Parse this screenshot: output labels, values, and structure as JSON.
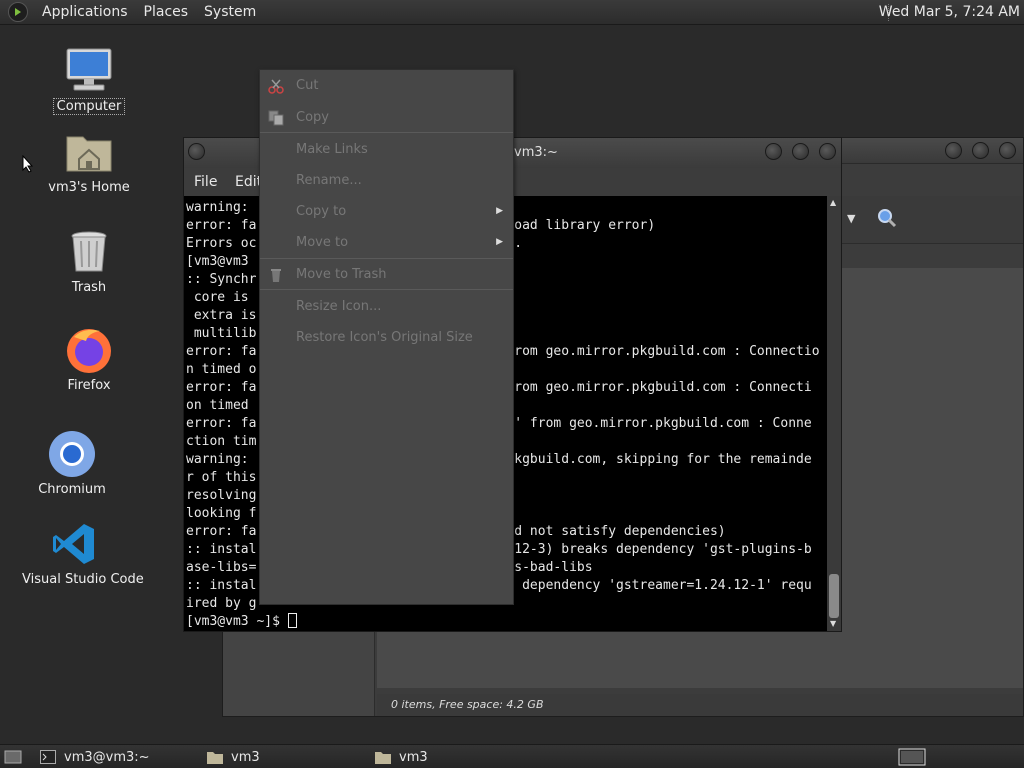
{
  "top_panel": {
    "menus": [
      "Applications",
      "Places",
      "System"
    ],
    "clock": "Wed Mar  5,  7:24 AM"
  },
  "desktop": {
    "icons": [
      {
        "label": "Computer",
        "icon": "computer-icon"
      },
      {
        "label": "vm3's Home",
        "icon": "home-folder-icon"
      },
      {
        "label": "Trash",
        "icon": "trash-icon"
      },
      {
        "label": "Firefox",
        "icon": "firefox-icon"
      },
      {
        "label": "Chromium",
        "icon": "chromium-icon"
      },
      {
        "label": "Visual Studio Code",
        "icon": "vscode-icon"
      }
    ]
  },
  "file_manager": {
    "status": "0 items, Free space: 4.2 GB"
  },
  "terminal": {
    "title": "vm3:~",
    "menus": [
      "File",
      "Edit"
    ],
    "lines": [
      {
        "left": "warning: ",
        "right": ""
      },
      {
        "left": "error: fa",
        "right": "load library error)"
      },
      {
        "left": "Errors oc",
        "right": "d."
      },
      {
        "left": "[vm3@vm3 ",
        "right": ""
      },
      {
        "left": ":: Synchr",
        "right": ""
      },
      {
        "left": " core is ",
        "right": ""
      },
      {
        "left": " extra is",
        "right": ""
      },
      {
        "left": " multilib",
        "right": ""
      },
      {
        "left": "error: fa",
        "right": "from geo.mirror.pkgbuild.com : Connectio"
      },
      {
        "left": "n timed o",
        "right": ""
      },
      {
        "left": "error: fa",
        "right": "from geo.mirror.pkgbuild.com : Connecti"
      },
      {
        "left": "on timed ",
        "right": ""
      },
      {
        "left": "error: fa",
        "right": "b' from geo.mirror.pkgbuild.com : Conne"
      },
      {
        "left": "ction tim",
        "right": ""
      },
      {
        "left": "warning: ",
        "right": "pkgbuild.com, skipping for the remainde"
      },
      {
        "left": "r of this",
        "right": ""
      },
      {
        "left": "resolving",
        "right": ""
      },
      {
        "left": "looking f",
        "right": ""
      },
      {
        "left": "error: fa",
        "right": "ld not satisfy dependencies)"
      },
      {
        "left": ":: instal",
        "right": ".12-3) breaks dependency 'gst-plugins-b"
      },
      {
        "left": "ase-libs=",
        "right": "ns-bad-libs"
      },
      {
        "left": ":: instal",
        "right": "s dependency 'gstreamer=1.24.12-1' requ"
      },
      {
        "left": "ired by g",
        "right": ""
      }
    ],
    "prompt": "[vm3@vm3 ~]$ "
  },
  "context_menu": {
    "items": [
      {
        "label": "Cut",
        "icon": "scissors-icon",
        "submenu": false
      },
      {
        "label": "Copy",
        "icon": "copy-icon",
        "submenu": false
      },
      {
        "label": "Make Links",
        "icon": "",
        "submenu": false
      },
      {
        "label": "Rename...",
        "icon": "",
        "submenu": false
      },
      {
        "label": "Copy to",
        "icon": "",
        "submenu": true
      },
      {
        "label": "Move to",
        "icon": "",
        "submenu": true
      },
      {
        "label": "Move to Trash",
        "icon": "trash-icon",
        "submenu": false
      },
      {
        "label": "Resize Icon...",
        "icon": "",
        "submenu": false
      },
      {
        "label": "Restore Icon's Original Size",
        "icon": "",
        "submenu": false
      }
    ]
  },
  "taskbar": {
    "tasks": [
      {
        "label": "vm3@vm3:~",
        "icon": "terminal-icon"
      },
      {
        "label": "vm3",
        "icon": "folder-icon"
      },
      {
        "label": "vm3",
        "icon": "folder-icon"
      }
    ]
  }
}
